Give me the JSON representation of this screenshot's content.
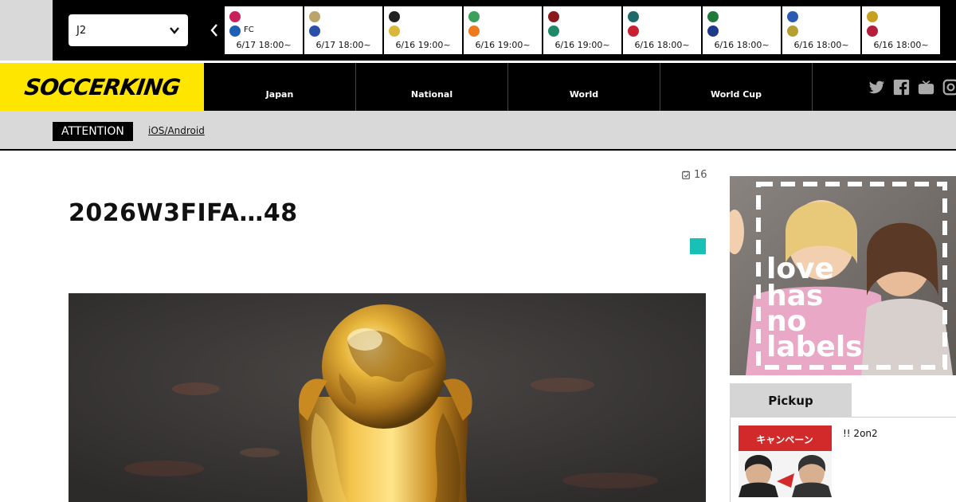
{
  "topbar": {
    "league_select": "J2",
    "matches": [
      {
        "home_color": "#c8205a",
        "away_color": "#1e5fb4",
        "away_name": "FC",
        "time": "6/17 18:00~"
      },
      {
        "home_color": "#b9a56a",
        "away_color": "#2a4fa8",
        "away_name": "",
        "time": "6/17 18:00~"
      },
      {
        "home_color": "#222222",
        "away_color": "#d9b73a",
        "away_name": "",
        "time": "6/16 19:00~"
      },
      {
        "home_color": "#3aa05a",
        "away_color": "#ee7a1e",
        "away_name": "",
        "time": "6/16 19:00~"
      },
      {
        "home_color": "#8a1a1a",
        "away_color": "#1e8a6a",
        "away_name": "",
        "time": "6/16 19:00~"
      },
      {
        "home_color": "#1e6a6a",
        "away_color": "#c82030",
        "away_name": "",
        "time": "6/16 18:00~"
      },
      {
        "home_color": "#1e7a3a",
        "away_color": "#1e3a8a",
        "away_name": "",
        "time": "6/16 18:00~"
      },
      {
        "home_color": "#2a5ab4",
        "away_color": "#b4a030",
        "away_name": "",
        "time": "6/16 18:00~"
      },
      {
        "home_color": "#c8a020",
        "away_color": "#b41e3a",
        "away_name": "",
        "time": "6/16 18:00~"
      }
    ]
  },
  "header": {
    "logo": "SOCCERKING",
    "nav": [
      "Japan",
      "National",
      "World",
      "World Cup"
    ]
  },
  "attention": {
    "label": "ATTENTION",
    "link": "iOS/Android"
  },
  "article": {
    "comment_count": "16",
    "title": "2026W3FIFA…48"
  },
  "ad": {
    "text_lines": [
      "love",
      "has",
      "no",
      "labels"
    ]
  },
  "sidebar": {
    "tab_label": "Pickup",
    "pickup_text": "!! 2on2",
    "pickup_image_text": "キャンペーン"
  },
  "colors": {
    "accent_yellow": "#ffe600",
    "teal": "#19c0b6"
  }
}
